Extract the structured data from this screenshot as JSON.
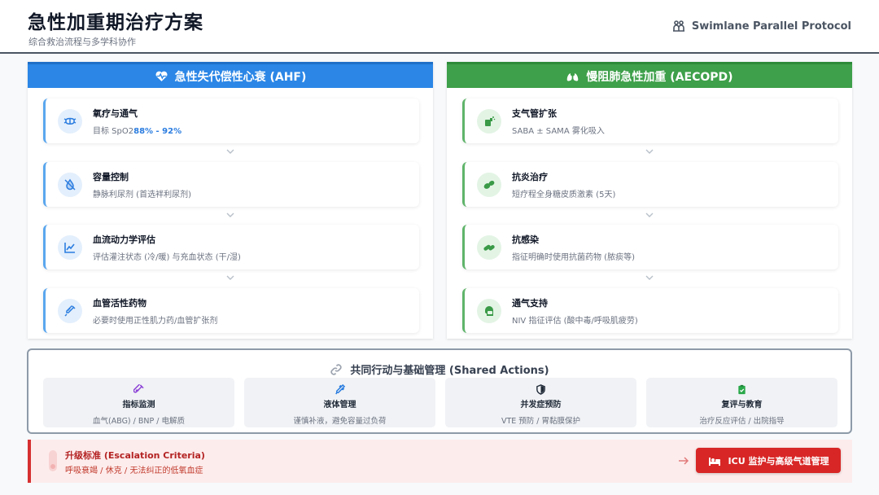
{
  "header": {
    "title": "急性加重期治疗方案",
    "subtitle": "综合救治流程与多学科协作",
    "protocol": "Swimlane Parallel Protocol",
    "protocol_icon": "people-lane-icon"
  },
  "colors": {
    "ahf_accent": "#2b86e6",
    "aecopd_accent": "#3ea04a",
    "escalation": "#d82626"
  },
  "lanes": {
    "ahf": {
      "title": "急性失代偿性心衰 (AHF)",
      "icon": "heartbeat-icon",
      "steps": [
        {
          "name": "氧疗与通气",
          "desc_prefix": "目标 SpO2",
          "desc_highlight": "88% - 92%",
          "icon": "mask-icon"
        },
        {
          "name": "容量控制",
          "desc": "静脉利尿剂 (首选袢利尿剂)",
          "icon": "no-droplet-icon"
        },
        {
          "name": "血流动力学评估",
          "desc": "评估灌注状态 (冷/暖) 与充血状态 (干/湿)",
          "icon": "chart-line-icon"
        },
        {
          "name": "血管活性药物",
          "desc": "必要时使用正性肌力药/血管扩张剂",
          "icon": "syringe-icon"
        }
      ]
    },
    "aecopd": {
      "title": "慢阻肺急性加重 (AECOPD)",
      "icon": "lungs-icon",
      "steps": [
        {
          "name": "支气管扩张",
          "desc": "SABA ± SAMA 雾化吸入",
          "icon": "inhaler-icon"
        },
        {
          "name": "抗炎治疗",
          "desc": "短疗程全身糖皮质激素 (5天)",
          "icon": "tablets-icon"
        },
        {
          "name": "抗感染",
          "desc": "指征明确时使用抗菌药物 (脓痰等)",
          "icon": "capsules-icon"
        },
        {
          "name": "通气支持",
          "desc": "NIV 指征评估 (酸中毒/呼吸肌疲劳)",
          "icon": "head-side-mask-icon"
        }
      ]
    }
  },
  "shared": {
    "title": "共同行动与基础管理 (Shared Actions)",
    "icon": "link-icon",
    "cards": [
      {
        "name": "指标监测",
        "desc": "血气(ABG) / BNP / 电解质",
        "icon": "vial-icon",
        "color": "#8b3fd6"
      },
      {
        "name": "液体管理",
        "desc": "谨慎补液，避免容量过负荷",
        "icon": "dropper-icon",
        "color": "#2b7de0"
      },
      {
        "name": "并发症预防",
        "desc": "VTE 预防 / 胃黏膜保护",
        "icon": "shield-icon",
        "color": "#1f2937"
      },
      {
        "name": "复评与教育",
        "desc": "治疗反应评估 / 出院指导",
        "icon": "clipboard-check-icon",
        "color": "#2aa84a"
      }
    ]
  },
  "escalation": {
    "title": "升级标准 (Escalation Criteria)",
    "desc": "呼吸衰竭 / 休克 / 无法纠正的低氧血症",
    "button": "ICU 监护与高级气道管理",
    "button_icon": "bed-icon",
    "indicator_icon": "thermometer-icon"
  }
}
